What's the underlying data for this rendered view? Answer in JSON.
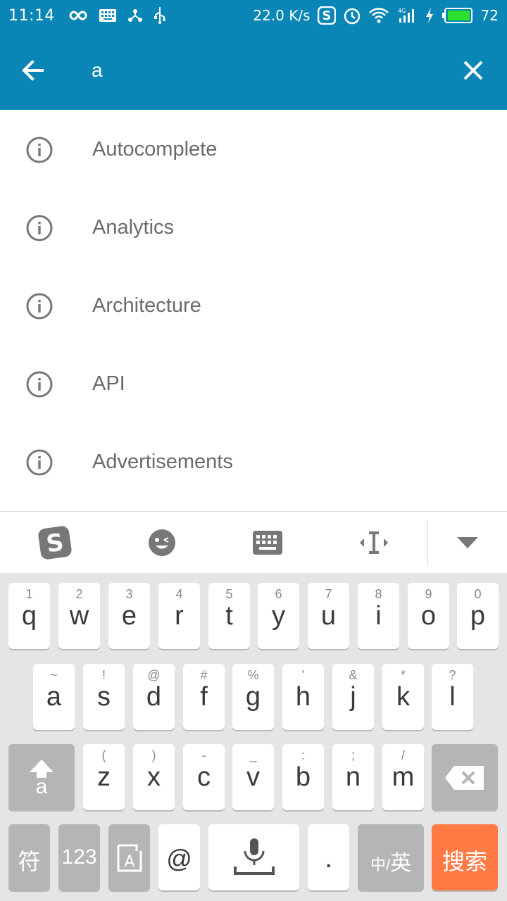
{
  "status_bar": {
    "time": "11:14",
    "speed": "22.0 K/s",
    "battery": "72",
    "icons": [
      "infinity-icon",
      "keyboard-icon",
      "share-icon",
      "usb-icon",
      "sogou-icon",
      "alarm-icon",
      "wifi-icon",
      "signal-4g-icon",
      "charging-icon",
      "battery-icon"
    ]
  },
  "search": {
    "query": "a"
  },
  "suggestions": [
    {
      "label": "Autocomplete"
    },
    {
      "label": "Analytics"
    },
    {
      "label": "Architecture"
    },
    {
      "label": "API"
    },
    {
      "label": "Advertisements"
    }
  ],
  "keyboard": {
    "row1": [
      {
        "sub": "1",
        "main": "q"
      },
      {
        "sub": "2",
        "main": "w"
      },
      {
        "sub": "3",
        "main": "e"
      },
      {
        "sub": "4",
        "main": "r"
      },
      {
        "sub": "5",
        "main": "t"
      },
      {
        "sub": "6",
        "main": "y"
      },
      {
        "sub": "7",
        "main": "u"
      },
      {
        "sub": "8",
        "main": "i"
      },
      {
        "sub": "9",
        "main": "o"
      },
      {
        "sub": "0",
        "main": "p"
      }
    ],
    "row2": [
      {
        "sub": "~",
        "main": "a"
      },
      {
        "sub": "!",
        "main": "s"
      },
      {
        "sub": "@",
        "main": "d"
      },
      {
        "sub": "#",
        "main": "f"
      },
      {
        "sub": "%",
        "main": "g"
      },
      {
        "sub": "'",
        "main": "h"
      },
      {
        "sub": "&",
        "main": "j"
      },
      {
        "sub": "*",
        "main": "k"
      },
      {
        "sub": "?",
        "main": "l"
      }
    ],
    "row3": [
      {
        "sub": "(",
        "main": "z"
      },
      {
        "sub": ")",
        "main": "x"
      },
      {
        "sub": "-",
        "main": "c"
      },
      {
        "sub": "_",
        "main": "v"
      },
      {
        "sub": ":",
        "main": "b"
      },
      {
        "sub": ";",
        "main": "n"
      },
      {
        "sub": "/",
        "main": "m"
      }
    ],
    "shift_label": "a",
    "row4": {
      "symbols": "符",
      "numbers": "123",
      "at": "@",
      "period": ".",
      "lang_cn": "中",
      "lang_sep": "/",
      "lang_en": "英",
      "search": "搜索"
    }
  },
  "colors": {
    "app_bar": "#0a86b6",
    "text_secondary": "#6b6b6b",
    "key_dark": "#b5b5b5",
    "search_key": "#ff7a45"
  }
}
